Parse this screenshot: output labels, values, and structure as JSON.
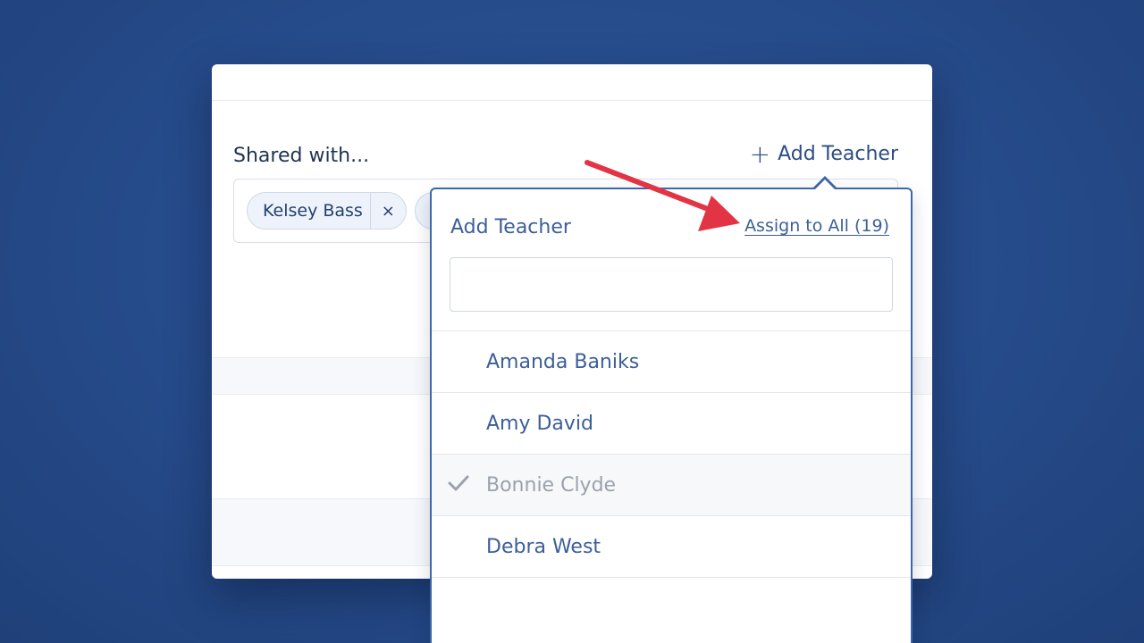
{
  "card": {
    "shared_label": "Shared with...",
    "add_teacher_label": "Add Teacher",
    "chips": [
      {
        "label": "Kelsey Bass",
        "remove": "×"
      }
    ]
  },
  "dropdown": {
    "title": "Add Teacher",
    "assign_all_label": "Assign to All (19)",
    "search": {
      "placeholder": "",
      "value": ""
    },
    "teachers": [
      {
        "name": "Amanda Baniks",
        "selected": false
      },
      {
        "name": "Amy David",
        "selected": false
      },
      {
        "name": "Bonnie Clyde",
        "selected": true
      },
      {
        "name": "Debra West",
        "selected": false
      }
    ]
  },
  "icons": {
    "add": "plus-icon",
    "remove": "close-icon",
    "check": "checkmark-icon",
    "annotation": "red-arrow"
  },
  "colors": {
    "background": "#264b8a",
    "accent": "#3c5f98",
    "annotation": "#e23444",
    "selected_text": "#9aa2ad"
  }
}
